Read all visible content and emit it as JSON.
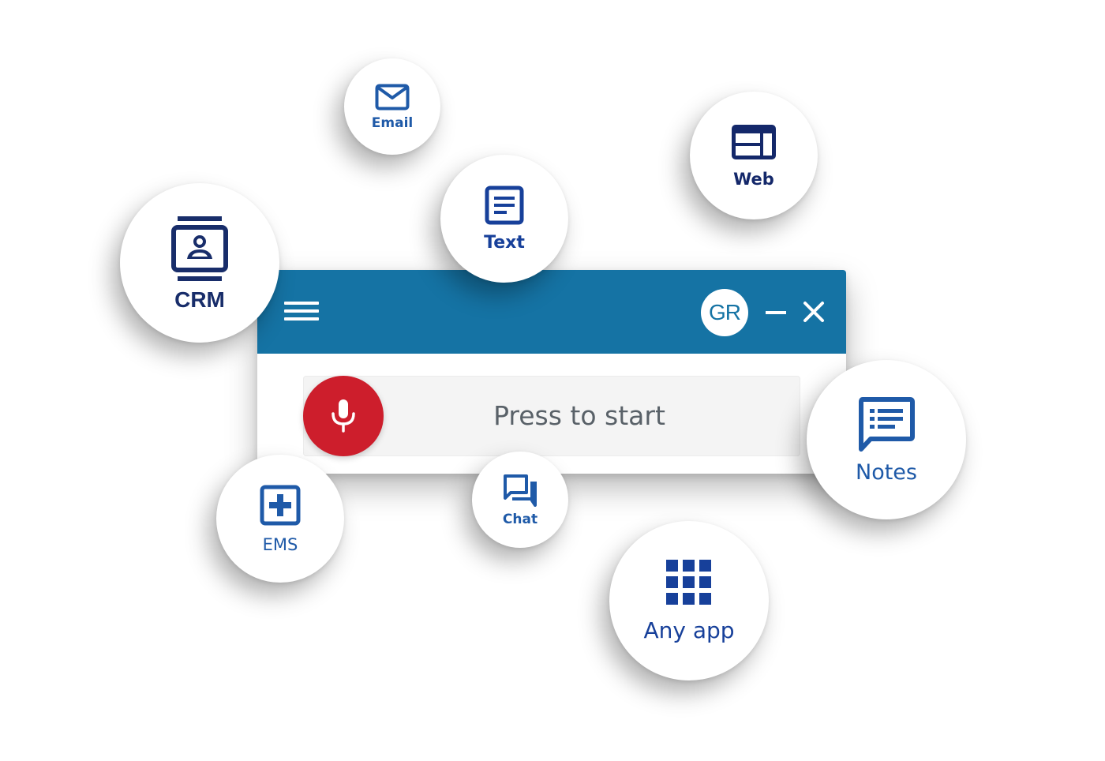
{
  "widget": {
    "header": {
      "menu_icon": "hamburger-menu-icon",
      "avatar_initials": "GR",
      "minimize_icon": "minimize-icon",
      "close_icon": "close-icon",
      "color": "#1573a4"
    },
    "body": {
      "mic_icon": "microphone-icon",
      "mic_color": "#cd1e2c",
      "prompt": "Press to start"
    }
  },
  "apps": [
    {
      "id": "email",
      "label": "Email",
      "icon": "envelope-icon"
    },
    {
      "id": "text",
      "label": "Text",
      "icon": "document-text-icon"
    },
    {
      "id": "web",
      "label": "Web",
      "icon": "browser-window-icon"
    },
    {
      "id": "crm",
      "label": "CRM",
      "icon": "contact-card-icon"
    },
    {
      "id": "notes",
      "label": "Notes",
      "icon": "notes-speech-bubble-icon"
    },
    {
      "id": "ems",
      "label": "EMS",
      "icon": "medical-cross-icon"
    },
    {
      "id": "chat",
      "label": "Chat",
      "icon": "chat-bubbles-icon"
    },
    {
      "id": "anyapp",
      "label": "Any app",
      "icon": "app-grid-icon"
    }
  ],
  "colors": {
    "icon_blue": "#1f5aa8",
    "icon_navy": "#14286a"
  }
}
